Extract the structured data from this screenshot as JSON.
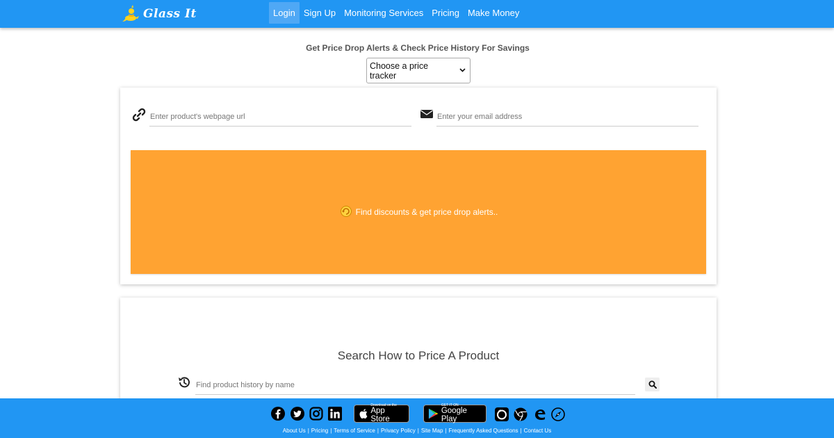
{
  "brand": {
    "name": "Glass It"
  },
  "nav": {
    "items": [
      {
        "label": "Login",
        "active": true
      },
      {
        "label": "Sign Up"
      },
      {
        "label": "Monitoring Services"
      },
      {
        "label": "Pricing"
      },
      {
        "label": "Make Money"
      }
    ]
  },
  "hero": {
    "tagline": "Get Price Drop Alerts & Check Price History For Savings",
    "select_value": "Choose a price tracker"
  },
  "alert_form": {
    "url_placeholder": "Enter product's webpage url",
    "email_placeholder": "Enter your email address",
    "submit_label": "Find discounts & get price drop alerts.."
  },
  "search": {
    "title": "Search How to Price A Product",
    "placeholder": "Find product history by name"
  },
  "footer": {
    "app_store": {
      "small": "Download on the",
      "big": "App Store"
    },
    "google_play": {
      "small": "GET IT ON",
      "big": "Google Play"
    },
    "links": [
      "About Us",
      "Pricing",
      "Terms of Service",
      "Privacy Policy",
      "Site Map",
      "Frequently Asked Questions",
      "Contact Us"
    ]
  },
  "colors": {
    "primary": "#2196f3",
    "accent": "#ffa332"
  }
}
